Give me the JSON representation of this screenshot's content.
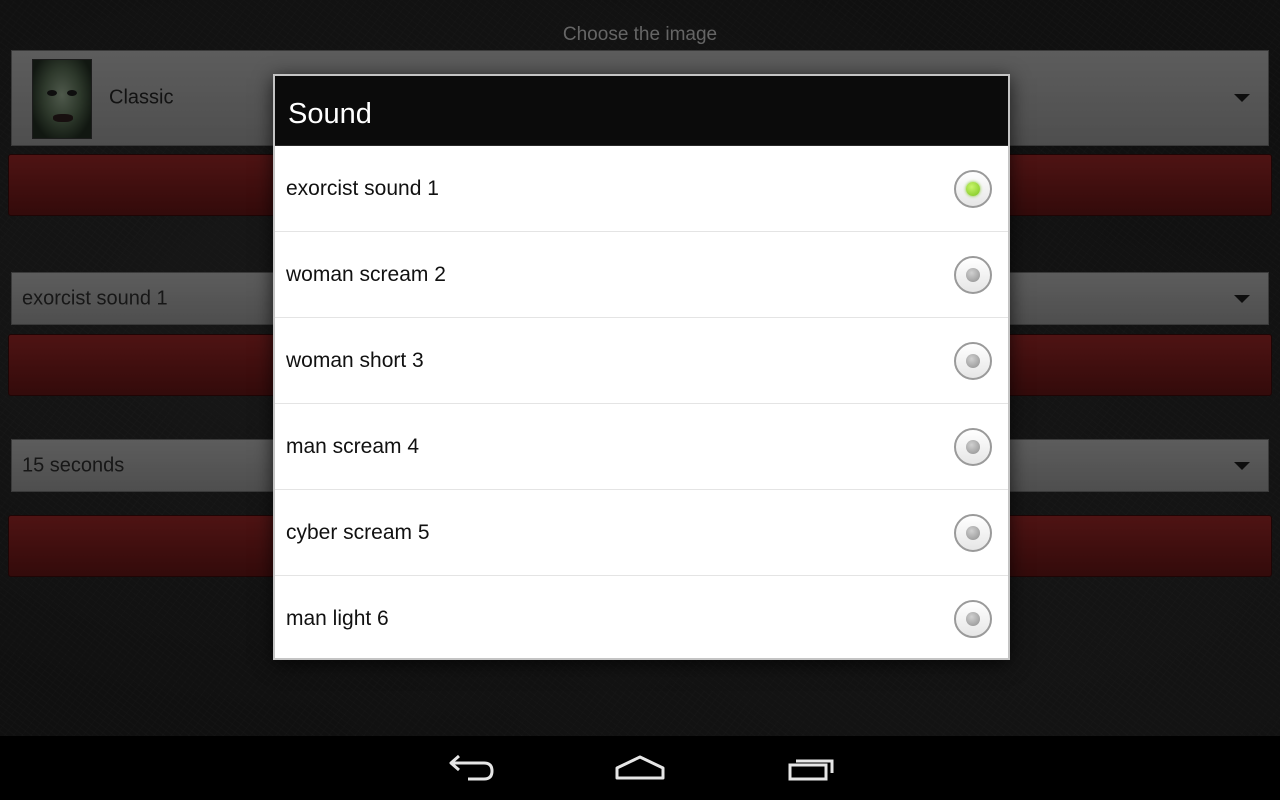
{
  "background": {
    "image_section_label": "Choose the image",
    "image_spinner_value": "Classic",
    "sound_spinner_value": "exorcist sound 1",
    "time_spinner_value": "15 seconds"
  },
  "dialog": {
    "title": "Sound",
    "options": [
      {
        "label": "exorcist sound 1",
        "checked": true
      },
      {
        "label": "woman scream 2",
        "checked": false
      },
      {
        "label": "woman short 3",
        "checked": false
      },
      {
        "label": "man scream 4",
        "checked": false
      },
      {
        "label": "cyber scream 5",
        "checked": false
      },
      {
        "label": "man light 6",
        "checked": false
      }
    ]
  },
  "navbar": {
    "icons": [
      "back-icon",
      "home-icon",
      "recent-apps-icon"
    ]
  },
  "colors": {
    "accent_radio": "#7ac41d",
    "button_red": "#8f2424",
    "dialog_title_bg": "#0b0b0b"
  }
}
